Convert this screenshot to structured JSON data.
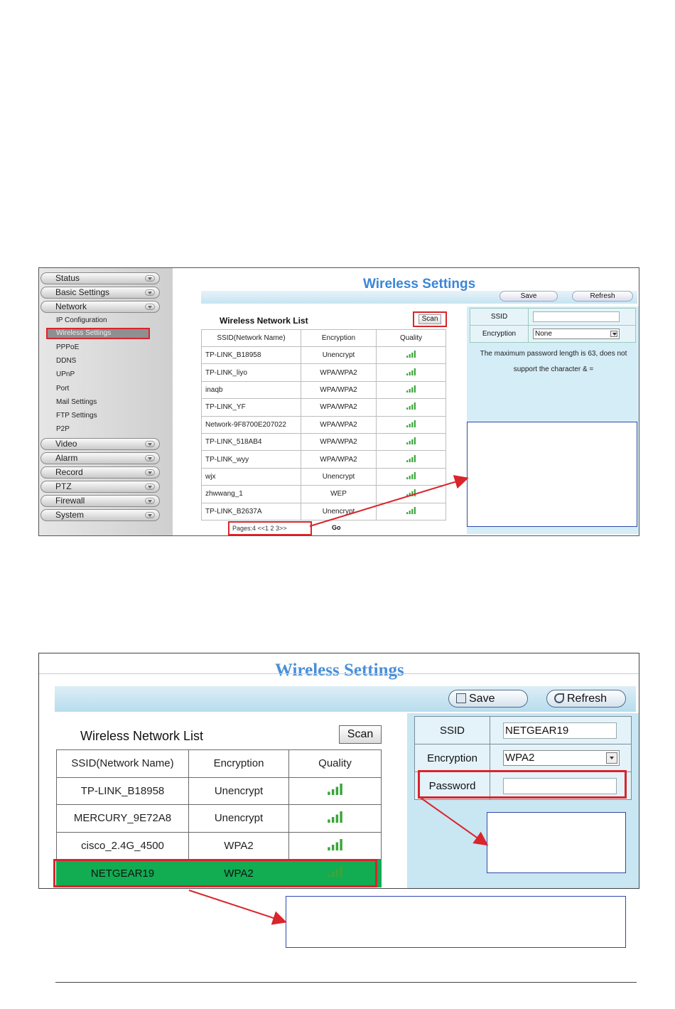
{
  "shot1": {
    "title": "Wireless Settings",
    "toolbar": {
      "save": "Save",
      "refresh": "Refresh"
    },
    "sidebar": {
      "groups_top": [
        "Status",
        "Basic Settings",
        "Network"
      ],
      "network_items": [
        "IP Configuration",
        "Wireless Settings",
        "PPPoE",
        "DDNS",
        "UPnP",
        "Port",
        "Mail Settings",
        "FTP Settings",
        "P2P"
      ],
      "groups_bottom": [
        "Video",
        "Alarm",
        "Record",
        "PTZ",
        "Firewall",
        "System"
      ]
    },
    "list_title": "Wireless Network List",
    "scan": "Scan",
    "columns": [
      "SSID(Network Name)",
      "Encryption",
      "Quality"
    ],
    "rows": [
      [
        "TP-LINK_B18958",
        "Unencrypt"
      ],
      [
        "TP-LINK_liyo",
        "WPA/WPA2"
      ],
      [
        "inaqb",
        "WPA/WPA2"
      ],
      [
        "TP-LINK_YF",
        "WPA/WPA2"
      ],
      [
        "Network-9F8700E207022",
        "WPA/WPA2"
      ],
      [
        "TP-LINK_518AB4",
        "WPA/WPA2"
      ],
      [
        "TP-LINK_wyy",
        "WPA/WPA2"
      ],
      [
        "wjx",
        "Unencrypt"
      ],
      [
        "zhwwang_1",
        "WEP"
      ],
      [
        "TP-LINK_B2637A",
        "Unencrypt"
      ]
    ],
    "pages": "Pages:4    <<1 2 3>>",
    "go": "Go",
    "form": {
      "ssid_label": "SSID",
      "ssid_value": "",
      "enc_label": "Encryption",
      "enc_value": "None"
    },
    "note_line1": "The maximum password length is 63, does not",
    "note_line2": "support the character & ="
  },
  "shot2": {
    "title": "Wireless Settings",
    "toolbar": {
      "save": "Save",
      "refresh": "Refresh"
    },
    "list_title": "Wireless Network List",
    "scan": "Scan",
    "columns": [
      "SSID(Network Name)",
      "Encryption",
      "Quality"
    ],
    "rows": [
      [
        "TP-LINK_B18958",
        "Unencrypt"
      ],
      [
        "MERCURY_9E72A8",
        "Unencrypt"
      ],
      [
        "cisco_2.4G_4500",
        "WPA2"
      ],
      [
        "NETGEAR19",
        "WPA2"
      ]
    ],
    "selected_row": 3,
    "form": {
      "ssid_label": "SSID",
      "ssid_value": "NETGEAR19",
      "enc_label": "Encryption",
      "enc_value": "WPA2",
      "pw_label": "Password",
      "pw_value": ""
    }
  },
  "colors": {
    "title_blue": "#3a86d6",
    "highlight_red": "#d9252b",
    "selected_green": "#12ac53",
    "panel_blue": "#c9e6f3",
    "callout_border": "#2f49a8"
  },
  "icons": {
    "quality": "signal-bars-icon",
    "dropdown": "chevron-down-icon",
    "save": "floppy-icon",
    "refresh": "refresh-arrow-icon"
  }
}
